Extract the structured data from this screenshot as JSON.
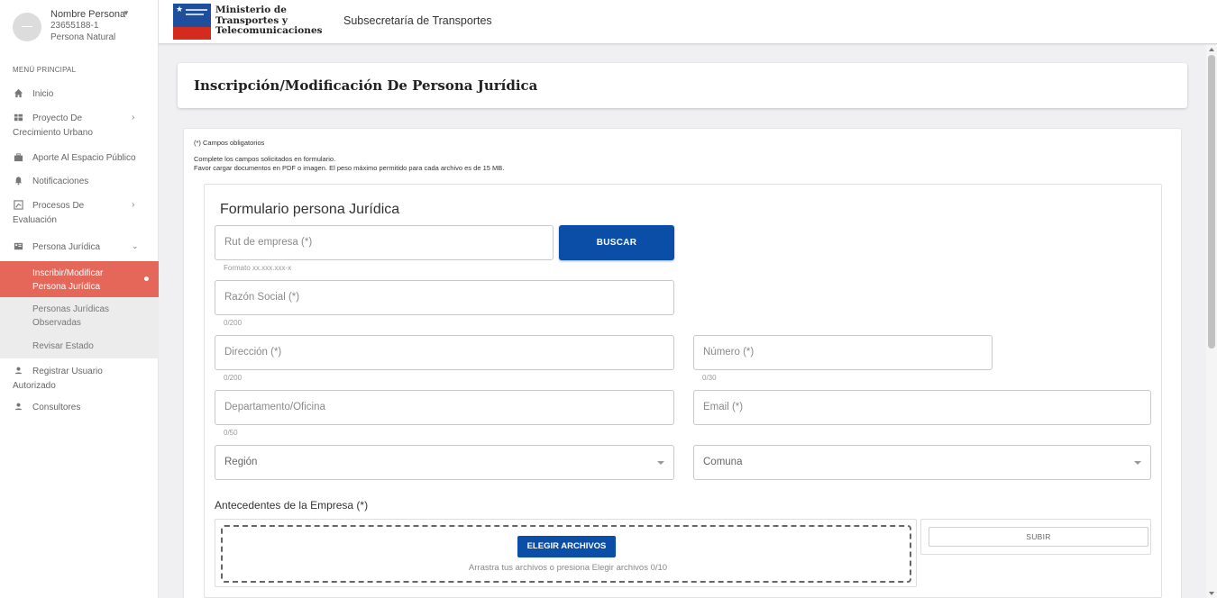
{
  "user": {
    "name": "Nombre Persona",
    "rut": "23655188-1",
    "type": "Persona Natural"
  },
  "sidebar": {
    "menu_title": "MENÚ PRINCIPAL",
    "items": [
      {
        "icon": "home-icon",
        "label": "Inicio"
      },
      {
        "icon": "dashboard-icon",
        "label_line1": "Proyecto De",
        "label_line2": "Crecimiento Urbano"
      },
      {
        "icon": "briefcase-icon",
        "label": "Aporte Al Espacio Público"
      },
      {
        "icon": "bell-icon",
        "label": "Notificaciones"
      },
      {
        "icon": "chart-icon",
        "label_line1": "Procesos De",
        "label_line2": "Evaluación"
      },
      {
        "icon": "building-icon",
        "label": "Persona Jurídica"
      },
      {
        "icon": "person-icon",
        "label_line1": "Registrar Usuario",
        "label_line2": "Autorizado"
      },
      {
        "icon": "person-icon",
        "label": "Consultores"
      }
    ],
    "subitems": [
      {
        "line1": "Inscribir/Modificar",
        "line2": "Persona Jurídica",
        "active": true
      },
      {
        "line1": "Personas Jurídicas",
        "line2": "Observadas"
      },
      {
        "line1": "Revisar Estado"
      }
    ]
  },
  "header": {
    "logo_line1": "Ministerio de",
    "logo_line2": "Transportes y",
    "logo_line3": "Telecomunicaciones",
    "subsecretaria": "Subsecretaría de Transportes"
  },
  "page": {
    "title": "Inscripción/Modificación De Persona Jurídica",
    "required_note": "(*) Campos obligatorios",
    "instructions_line1": "Complete los campos solicitados en formulario.",
    "instructions_line2": "Favor cargar documentos en PDF o imagen. El peso máximo permitido para cada archivo es de 15 MB."
  },
  "form": {
    "heading": "Formulario persona Jurídica",
    "rut": {
      "placeholder": "Rut de empresa (*)",
      "hint": "Formato xx.xxx.xxx-x"
    },
    "buscar_label": "BUSCAR",
    "razon_social": {
      "placeholder": "Razón Social (*)",
      "counter": "0/200"
    },
    "direccion": {
      "placeholder": "Dirección (*)",
      "counter": "0/200"
    },
    "numero": {
      "placeholder": "Número (*)",
      "counter": "0/30"
    },
    "departamento": {
      "placeholder": "Departamento/Oficina",
      "counter": "0/50"
    },
    "email": {
      "placeholder": "Email (*)"
    },
    "region": {
      "placeholder": "Región"
    },
    "comuna": {
      "placeholder": "Comuna"
    },
    "antecedentes_label": "Antecedentes de la Empresa (*)",
    "elegir_label": "ELEGIR ARCHIVOS",
    "upload_hint": "Arrastra tus archivos o presiona Elegir archivos 0/10",
    "subir_label": "SUBIR"
  },
  "colors": {
    "accent": "#0a4ea8",
    "active_menu": "#e5675a"
  }
}
